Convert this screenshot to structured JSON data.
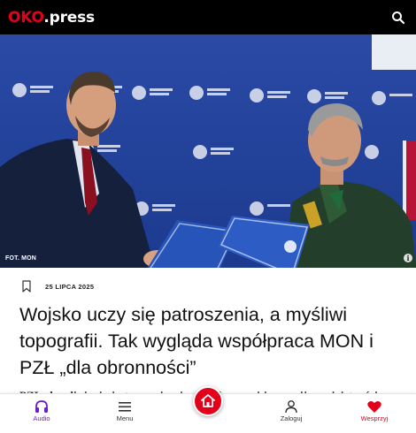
{
  "header": {
    "logo_brand": "OKO",
    "logo_dot": ".",
    "logo_tld": "press",
    "search_icon": "search-icon"
  },
  "hero": {
    "photo_credit": "FOT. MON",
    "info_icon": "info-icon"
  },
  "article": {
    "date": "25 LIPCA 2025",
    "title": "Wojsko uczy się patroszenia, a myśliwi topografii. Tak wygląda współpraca MON i PZŁ „dla obronności”",
    "lead": "PZŁ chwali się, że jest organizacją pro-obronną i że rozwija umiejętności",
    "bookmark_icon": "bookmark-icon"
  },
  "bottom_nav": {
    "items": [
      {
        "label": "Audio",
        "icon": "headphones-icon",
        "color": "#6b1fc8"
      },
      {
        "label": "Menu",
        "icon": "hamburger-icon",
        "color": "#333333"
      },
      {
        "label": "Zaloguj",
        "icon": "user-icon",
        "color": "#333333"
      },
      {
        "label": "Wesprzyj",
        "icon": "heart-icon",
        "color": "#e3001b"
      }
    ],
    "home_icon": "home-icon"
  },
  "colors": {
    "brand_red": "#e3001b",
    "audio_purple": "#6b1fc8",
    "header_bg": "#000000"
  }
}
